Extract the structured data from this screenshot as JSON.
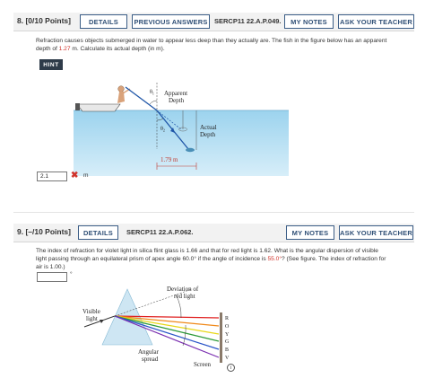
{
  "q8": {
    "points": "8. [0/10 Points]",
    "details": "DETAILS",
    "previous_answers": "PREVIOUS ANSWERS",
    "id": "SERCP11 22.A.P.049.",
    "my_notes": "MY NOTES",
    "ask_teacher": "ASK YOUR TEACHER",
    "text_a": "Refraction causes objects submerged in water to appear less deep than they actually are. The fish in the figure below has an apparent",
    "text_b": "depth of ",
    "depth_value": "1.27",
    "text_c": " m. Calculate its actual depth (in m).",
    "hint": "HINT",
    "figure": {
      "apparent": "Apparent",
      "depth": "Depth",
      "actual": "Actual",
      "actual_depth": "Depth",
      "theta1": "θ",
      "theta1_sub": "1",
      "theta2": "θ",
      "theta2_sub": "2",
      "distance": "1.79 m"
    },
    "answer": "2.1",
    "answer_status": "✖",
    "unit": "m"
  },
  "q9": {
    "points": "9. [–/10 Points]",
    "details": "DETAILS",
    "id": "SERCP11 22.A.P.062.",
    "my_notes": "MY NOTES",
    "ask_teacher": "ASK YOUR TEACHER",
    "text_a": "The index of refraction for violet light in silica flint glass is 1.66 and that for red light is 1.62. What is the angular dispersion of visible",
    "text_b": "light passing through an equilateral prism of apex angle 60.0° if the angle of incidence is ",
    "angle_value": "55.0°",
    "text_c": "? (See figure. The index of refraction for",
    "text_d": "air is 1.00.)",
    "answer": "",
    "unit": "°",
    "figure": {
      "deviation": "Deviation of",
      "red_light": "red light",
      "visible": "Visible",
      "light": "light",
      "angular": "Angular",
      "spread": "spread",
      "screen": "Screen",
      "colors": [
        "R",
        "O",
        "Y",
        "G",
        "B",
        "V"
      ],
      "info": "i"
    }
  }
}
